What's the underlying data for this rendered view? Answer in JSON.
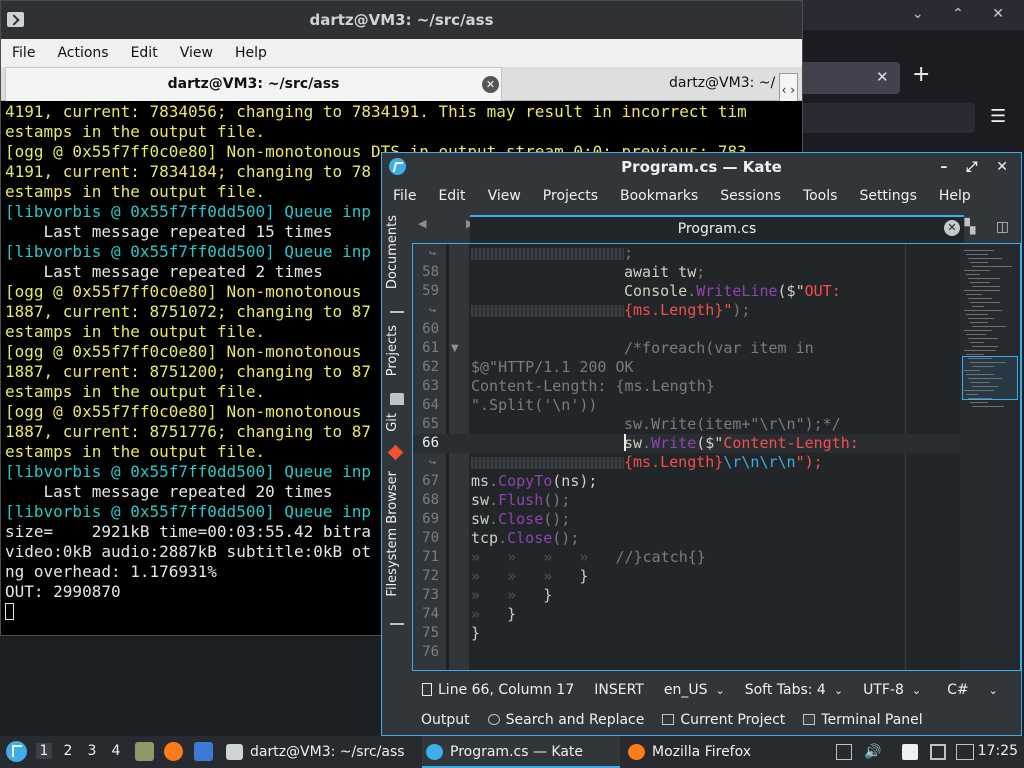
{
  "firefox_bg": {
    "window_controls": "⌄ ⌃ ✕",
    "tab_close": "✕",
    "new_tab": "+",
    "menu_icon": "☰"
  },
  "terminal": {
    "title": "dartz@VM3: ~/src/ass",
    "menu": [
      "File",
      "Actions",
      "Edit",
      "View",
      "Help"
    ],
    "tabs": [
      "dartz@VM3: ~/src/ass",
      "dartz@VM3: ~/"
    ],
    "tab_close": "✕",
    "tab_arrows": "‹ ›",
    "lines": [
      {
        "text": "4191, current: 7834056; changing to 7834191. This may result in incorrect tim",
        "color": "yellow"
      },
      {
        "text": "estamps in the output file.",
        "color": "yellow"
      },
      {
        "text": "[ogg @ 0x55f7ff0c0e80] Non-monotonous DTS in output stream 0:0; previous: 783",
        "color": "yellow"
      },
      {
        "text": "4191, current: 7834184; changing to 78",
        "color": "yellow"
      },
      {
        "text": "estamps in the output file.",
        "color": "yellow"
      },
      {
        "text": "[libvorbis @ 0x55f7ff0dd500] Queue inp",
        "color": "cyan"
      },
      {
        "text": "    Last message repeated 15 times",
        "color": "white"
      },
      {
        "text": "[libvorbis @ 0x55f7ff0dd500] Queue inp",
        "color": "cyan"
      },
      {
        "text": "    Last message repeated 2 times",
        "color": "white"
      },
      {
        "text": "[ogg @ 0x55f7ff0c0e80] Non-monotonous ",
        "color": "yellow"
      },
      {
        "text": "1887, current: 8751072; changing to 87",
        "color": "yellow"
      },
      {
        "text": "estamps in the output file.",
        "color": "yellow"
      },
      {
        "text": "[ogg @ 0x55f7ff0c0e80] Non-monotonous ",
        "color": "yellow"
      },
      {
        "text": "1887, current: 8751200; changing to 87",
        "color": "yellow"
      },
      {
        "text": "estamps in the output file.",
        "color": "yellow"
      },
      {
        "text": "[ogg @ 0x55f7ff0c0e80] Non-monotonous ",
        "color": "yellow"
      },
      {
        "text": "1887, current: 8751776; changing to 87",
        "color": "yellow"
      },
      {
        "text": "estamps in the output file.",
        "color": "yellow"
      },
      {
        "text": "[libvorbis @ 0x55f7ff0dd500] Queue inp",
        "color": "cyan"
      },
      {
        "text": "    Last message repeated 20 times",
        "color": "white"
      },
      {
        "text": "[libvorbis @ 0x55f7ff0dd500] Queue inp",
        "color": "cyan"
      },
      {
        "text": "size=    2921kB time=00:03:55.42 bitra",
        "color": "white"
      },
      {
        "text": "video:0kB audio:2887kB subtitle:0kB ot",
        "color": "white"
      },
      {
        "text": "ng overhead: 1.176931%",
        "color": "white"
      },
      {
        "text": "OUT: 2990870",
        "color": "white"
      }
    ]
  },
  "kate": {
    "title": "Program.cs  — Kate",
    "window_controls": "– ⤢ ✕",
    "menu": [
      "File",
      "Edit",
      "View",
      "Projects",
      "Bookmarks",
      "Sessions",
      "Tools",
      "Settings",
      "Help"
    ],
    "side_tabs": [
      "Documents",
      "Projects",
      "Git",
      "Filesystem Browser"
    ],
    "tab_nav": "◀ ▶",
    "file_tab": "Program.cs",
    "tab_close": "✕",
    "split_icons": "▚ ◫",
    "code": [
      {
        "ln": "",
        "wrap": true,
        "pad": true,
        "text": [
          {
            "t": ";",
            "c": "cm"
          }
        ]
      },
      {
        "ln": "58",
        "pad_space": true,
        "text": [
          {
            "t": "await tw",
            "c": "k"
          },
          {
            "t": ";",
            "c": "cm"
          }
        ]
      },
      {
        "ln": "59",
        "pad_space": true,
        "text": [
          {
            "t": "Console",
            "c": "k"
          },
          {
            "t": ".",
            "c": "cm"
          },
          {
            "t": "WriteLine",
            "c": "fn"
          },
          {
            "t": "($\"",
            "c": "k"
          },
          {
            "t": "OUT:",
            "c": "str"
          }
        ]
      },
      {
        "ln": "",
        "wrap": true,
        "pad": true,
        "text": [
          {
            "t": "{ms.Length}\"",
            "c": "str"
          },
          {
            "t": ");",
            "c": "cm"
          }
        ]
      },
      {
        "ln": "60",
        "text": []
      },
      {
        "ln": "61",
        "pad_space": true,
        "text": [
          {
            "t": "/*foreach(var item in",
            "c": "cm"
          }
        ]
      },
      {
        "ln": "62",
        "text": [
          {
            "t": "$@\"HTTP/1.1 200 OK",
            "c": "cm"
          }
        ]
      },
      {
        "ln": "63",
        "text": [
          {
            "t": "Content-Length: {ms.Length}",
            "c": "cm"
          }
        ]
      },
      {
        "ln": "64",
        "text": [
          {
            "t": "\".Split('\\n'))",
            "c": "cm"
          }
        ]
      },
      {
        "ln": "65",
        "pad_space": true,
        "text": [
          {
            "t": "sw.Write(item+\"\\r\\n\");*/",
            "c": "cm"
          }
        ]
      },
      {
        "ln": "66",
        "current": true,
        "pad_space": true,
        "cursor": true,
        "text": [
          {
            "t": "sw",
            "c": "k"
          },
          {
            "t": ".",
            "c": "cm"
          },
          {
            "t": "Write",
            "c": "fn"
          },
          {
            "t": "($\"",
            "c": "k"
          },
          {
            "t": "Content-Length:",
            "c": "str"
          }
        ]
      },
      {
        "ln": "",
        "wrap": true,
        "pad": true,
        "text": [
          {
            "t": "{ms.Length}",
            "c": "str"
          },
          {
            "t": "\\r\\n\\r\\n",
            "c": "esc"
          },
          {
            "t": "\");",
            "c": "str"
          }
        ]
      },
      {
        "ln": "67",
        "text": [
          {
            "t": "ms",
            "c": "k"
          },
          {
            "t": ".",
            "c": "cm"
          },
          {
            "t": "CopyTo",
            "c": "fn"
          },
          {
            "t": "(ns);",
            "k": 1,
            "c": "k"
          }
        ]
      },
      {
        "ln": "68",
        "text": [
          {
            "t": "sw",
            "c": "k"
          },
          {
            "t": ".",
            "c": "cm"
          },
          {
            "t": "Flush",
            "c": "fn"
          },
          {
            "t": "();",
            "c": "cm"
          }
        ]
      },
      {
        "ln": "69",
        "text": [
          {
            "t": "sw",
            "c": "k"
          },
          {
            "t": ".",
            "c": "cm"
          },
          {
            "t": "Close",
            "c": "fn"
          },
          {
            "t": "();",
            "c": "cm"
          }
        ]
      },
      {
        "ln": "70",
        "text": [
          {
            "t": "tcp",
            "c": "k"
          },
          {
            "t": ".",
            "c": "cm"
          },
          {
            "t": "Close",
            "c": "fn"
          },
          {
            "t": "();",
            "c": "cm"
          }
        ]
      },
      {
        "ln": "71",
        "text": [
          {
            "t": "»   »   »   »   ",
            "c": "tabs"
          },
          {
            "t": "//}catch{}",
            "c": "cm"
          }
        ]
      },
      {
        "ln": "72",
        "text": [
          {
            "t": "»   »   »   ",
            "c": "tabs"
          },
          {
            "t": "}",
            "c": "k"
          }
        ]
      },
      {
        "ln": "73",
        "text": [
          {
            "t": "»   »   ",
            "c": "tabs"
          },
          {
            "t": "}",
            "c": "k"
          }
        ]
      },
      {
        "ln": "74",
        "text": [
          {
            "t": "»   ",
            "c": "tabs"
          },
          {
            "t": "}",
            "c": "k"
          }
        ]
      },
      {
        "ln": "75",
        "text": [
          {
            "t": "}",
            "c": "k"
          }
        ]
      },
      {
        "ln": "76",
        "text": []
      }
    ],
    "status": {
      "position": "Line 66, Column 17",
      "mode": "INSERT",
      "language": "en_US",
      "indent": "Soft Tabs: 4",
      "encoding": "UTF-8",
      "syntax": "C#"
    },
    "toolviews": [
      "Output",
      "Search and Replace",
      "Current Project",
      "Terminal Panel"
    ]
  },
  "taskbar": {
    "workspaces": [
      "1",
      "2",
      "3",
      "4"
    ],
    "tasks": [
      "dartz@VM3: ~/src/ass",
      "Program.cs — Kate",
      "Mozilla Firefox"
    ],
    "clock": "17:25"
  },
  "colors": {
    "kate_accent": "#3daee9",
    "term_yellow": "#e9e965",
    "term_cyan": "#28c8c8",
    "code_function": "#8e44ad",
    "code_string": "#f44f4f"
  }
}
